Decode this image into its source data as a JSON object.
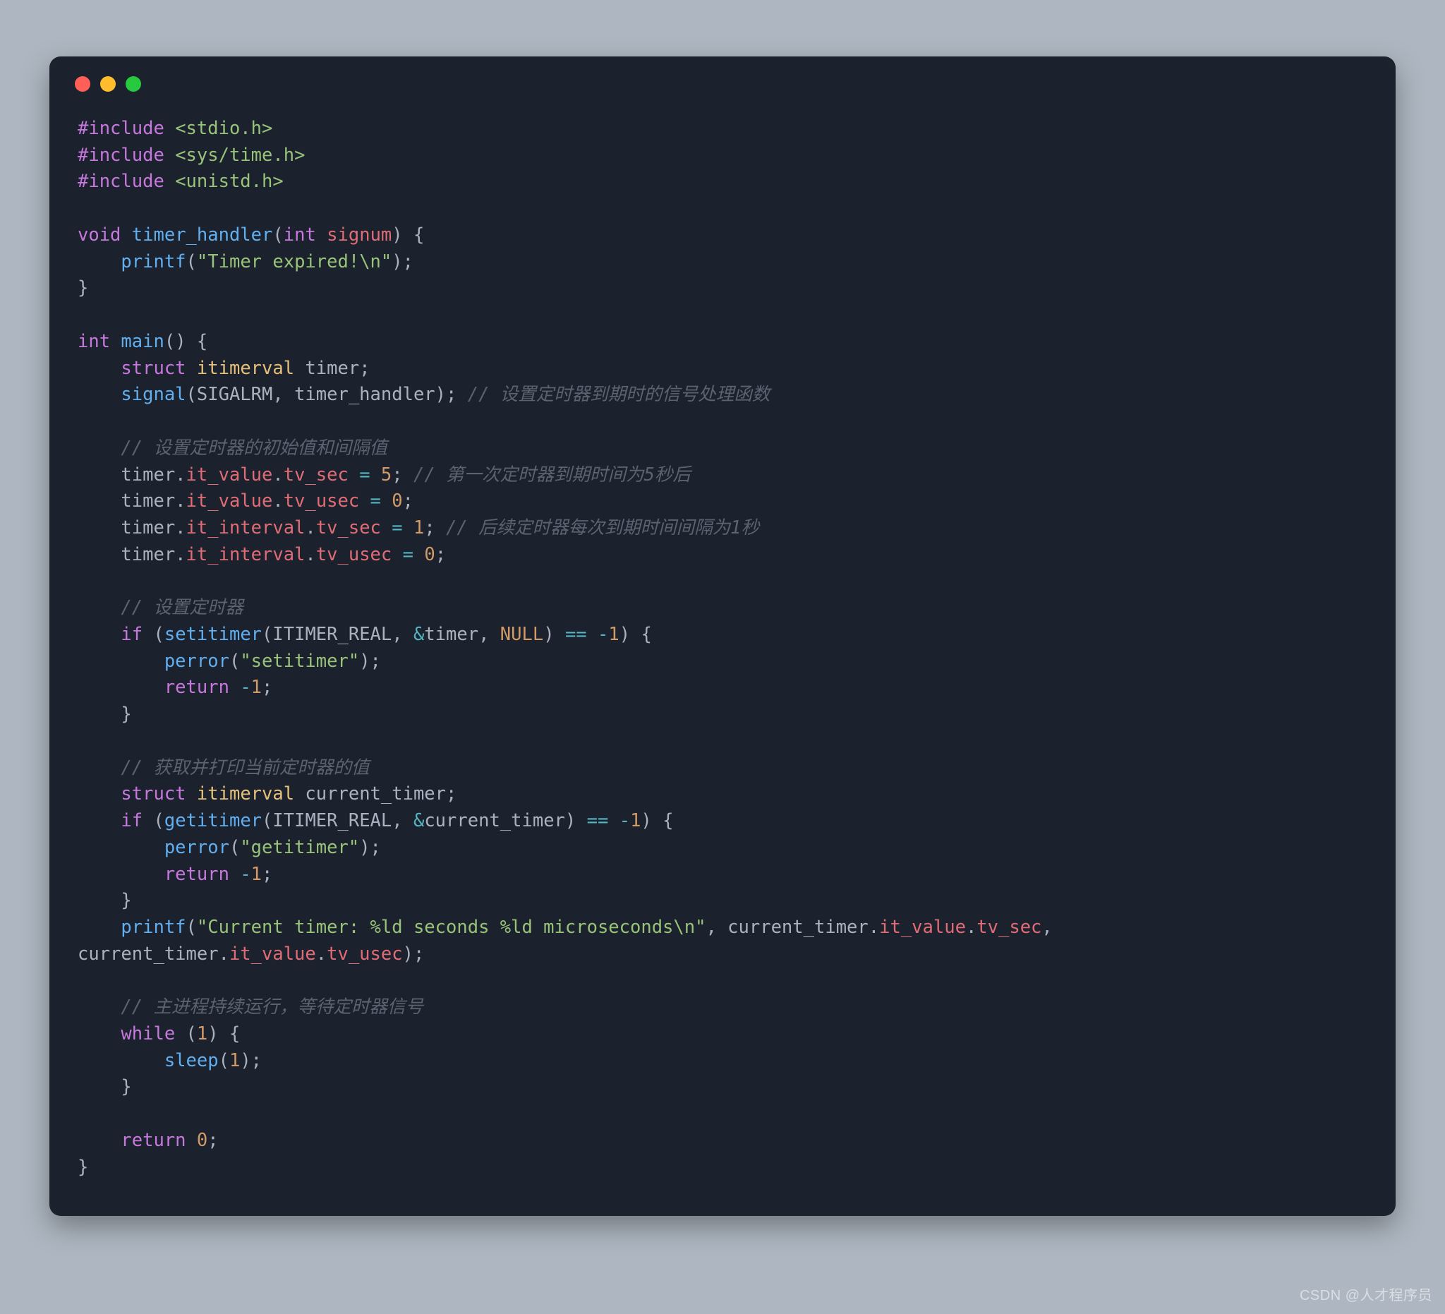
{
  "lines": [
    [
      {
        "c": "tok-pp",
        "t": "#include"
      },
      {
        "c": "tok-pun",
        "t": " "
      },
      {
        "c": "tok-inc",
        "t": "<stdio.h>"
      }
    ],
    [
      {
        "c": "tok-pp",
        "t": "#include"
      },
      {
        "c": "tok-pun",
        "t": " "
      },
      {
        "c": "tok-inc",
        "t": "<sys/time.h>"
      }
    ],
    [
      {
        "c": "tok-pp",
        "t": "#include"
      },
      {
        "c": "tok-pun",
        "t": " "
      },
      {
        "c": "tok-inc",
        "t": "<unistd.h>"
      }
    ],
    [],
    [
      {
        "c": "tok-type",
        "t": "void"
      },
      {
        "c": "tok-pun",
        "t": " "
      },
      {
        "c": "tok-fn",
        "t": "timer_handler"
      },
      {
        "c": "tok-pun",
        "t": "("
      },
      {
        "c": "tok-type",
        "t": "int"
      },
      {
        "c": "tok-pun",
        "t": " "
      },
      {
        "c": "tok-var",
        "t": "signum"
      },
      {
        "c": "tok-pun",
        "t": ") {"
      }
    ],
    [
      {
        "c": "tok-pun",
        "t": "    "
      },
      {
        "c": "tok-fncall",
        "t": "printf"
      },
      {
        "c": "tok-pun",
        "t": "("
      },
      {
        "c": "tok-str",
        "t": "\"Timer expired!\\n\""
      },
      {
        "c": "tok-pun",
        "t": ");"
      }
    ],
    [
      {
        "c": "tok-pun",
        "t": "}"
      }
    ],
    [],
    [
      {
        "c": "tok-type",
        "t": "int"
      },
      {
        "c": "tok-pun",
        "t": " "
      },
      {
        "c": "tok-fn",
        "t": "main"
      },
      {
        "c": "tok-pun",
        "t": "() {"
      }
    ],
    [
      {
        "c": "tok-pun",
        "t": "    "
      },
      {
        "c": "tok-struct",
        "t": "struct"
      },
      {
        "c": "tok-pun",
        "t": " "
      },
      {
        "c": "tok-stype",
        "t": "itimerval"
      },
      {
        "c": "tok-pun",
        "t": " timer;"
      }
    ],
    [
      {
        "c": "tok-pun",
        "t": "    "
      },
      {
        "c": "tok-fncall",
        "t": "signal"
      },
      {
        "c": "tok-pun",
        "t": "(SIGALRM, timer_handler); "
      },
      {
        "c": "tok-cmt",
        "t": "// 设置定时器到期时的信号处理函数"
      }
    ],
    [],
    [
      {
        "c": "tok-pun",
        "t": "    "
      },
      {
        "c": "tok-cmt",
        "t": "// 设置定时器的初始值和间隔值"
      }
    ],
    [
      {
        "c": "tok-pun",
        "t": "    timer."
      },
      {
        "c": "tok-mem",
        "t": "it_value"
      },
      {
        "c": "tok-pun",
        "t": "."
      },
      {
        "c": "tok-mem",
        "t": "tv_sec"
      },
      {
        "c": "tok-pun",
        "t": " "
      },
      {
        "c": "tok-op",
        "t": "="
      },
      {
        "c": "tok-pun",
        "t": " "
      },
      {
        "c": "tok-num",
        "t": "5"
      },
      {
        "c": "tok-pun",
        "t": "; "
      },
      {
        "c": "tok-cmt",
        "t": "// 第一次定时器到期时间为5秒后"
      }
    ],
    [
      {
        "c": "tok-pun",
        "t": "    timer."
      },
      {
        "c": "tok-mem",
        "t": "it_value"
      },
      {
        "c": "tok-pun",
        "t": "."
      },
      {
        "c": "tok-mem",
        "t": "tv_usec"
      },
      {
        "c": "tok-pun",
        "t": " "
      },
      {
        "c": "tok-op",
        "t": "="
      },
      {
        "c": "tok-pun",
        "t": " "
      },
      {
        "c": "tok-num",
        "t": "0"
      },
      {
        "c": "tok-pun",
        "t": ";"
      }
    ],
    [
      {
        "c": "tok-pun",
        "t": "    timer."
      },
      {
        "c": "tok-mem",
        "t": "it_interval"
      },
      {
        "c": "tok-pun",
        "t": "."
      },
      {
        "c": "tok-mem",
        "t": "tv_sec"
      },
      {
        "c": "tok-pun",
        "t": " "
      },
      {
        "c": "tok-op",
        "t": "="
      },
      {
        "c": "tok-pun",
        "t": " "
      },
      {
        "c": "tok-num",
        "t": "1"
      },
      {
        "c": "tok-pun",
        "t": "; "
      },
      {
        "c": "tok-cmt",
        "t": "// 后续定时器每次到期时间间隔为1秒"
      }
    ],
    [
      {
        "c": "tok-pun",
        "t": "    timer."
      },
      {
        "c": "tok-mem",
        "t": "it_interval"
      },
      {
        "c": "tok-pun",
        "t": "."
      },
      {
        "c": "tok-mem",
        "t": "tv_usec"
      },
      {
        "c": "tok-pun",
        "t": " "
      },
      {
        "c": "tok-op",
        "t": "="
      },
      {
        "c": "tok-pun",
        "t": " "
      },
      {
        "c": "tok-num",
        "t": "0"
      },
      {
        "c": "tok-pun",
        "t": ";"
      }
    ],
    [],
    [
      {
        "c": "tok-pun",
        "t": "    "
      },
      {
        "c": "tok-cmt",
        "t": "// 设置定时器"
      }
    ],
    [
      {
        "c": "tok-pun",
        "t": "    "
      },
      {
        "c": "tok-kw",
        "t": "if"
      },
      {
        "c": "tok-pun",
        "t": " ("
      },
      {
        "c": "tok-fncall",
        "t": "setitimer"
      },
      {
        "c": "tok-pun",
        "t": "(ITIMER_REAL, "
      },
      {
        "c": "tok-op",
        "t": "&"
      },
      {
        "c": "tok-pun",
        "t": "timer, "
      },
      {
        "c": "tok-null",
        "t": "NULL"
      },
      {
        "c": "tok-pun",
        "t": ") "
      },
      {
        "c": "tok-op",
        "t": "=="
      },
      {
        "c": "tok-pun",
        "t": " "
      },
      {
        "c": "tok-op",
        "t": "-"
      },
      {
        "c": "tok-num",
        "t": "1"
      },
      {
        "c": "tok-pun",
        "t": ") {"
      }
    ],
    [
      {
        "c": "tok-pun",
        "t": "        "
      },
      {
        "c": "tok-fncall",
        "t": "perror"
      },
      {
        "c": "tok-pun",
        "t": "("
      },
      {
        "c": "tok-str",
        "t": "\"setitimer\""
      },
      {
        "c": "tok-pun",
        "t": ");"
      }
    ],
    [
      {
        "c": "tok-pun",
        "t": "        "
      },
      {
        "c": "tok-kw",
        "t": "return"
      },
      {
        "c": "tok-pun",
        "t": " "
      },
      {
        "c": "tok-op",
        "t": "-"
      },
      {
        "c": "tok-num",
        "t": "1"
      },
      {
        "c": "tok-pun",
        "t": ";"
      }
    ],
    [
      {
        "c": "tok-pun",
        "t": "    }"
      }
    ],
    [],
    [
      {
        "c": "tok-pun",
        "t": "    "
      },
      {
        "c": "tok-cmt",
        "t": "// 获取并打印当前定时器的值"
      }
    ],
    [
      {
        "c": "tok-pun",
        "t": "    "
      },
      {
        "c": "tok-struct",
        "t": "struct"
      },
      {
        "c": "tok-pun",
        "t": " "
      },
      {
        "c": "tok-stype",
        "t": "itimerval"
      },
      {
        "c": "tok-pun",
        "t": " current_timer;"
      }
    ],
    [
      {
        "c": "tok-pun",
        "t": "    "
      },
      {
        "c": "tok-kw",
        "t": "if"
      },
      {
        "c": "tok-pun",
        "t": " ("
      },
      {
        "c": "tok-fncall",
        "t": "getitimer"
      },
      {
        "c": "tok-pun",
        "t": "(ITIMER_REAL, "
      },
      {
        "c": "tok-op",
        "t": "&"
      },
      {
        "c": "tok-pun",
        "t": "current_timer) "
      },
      {
        "c": "tok-op",
        "t": "=="
      },
      {
        "c": "tok-pun",
        "t": " "
      },
      {
        "c": "tok-op",
        "t": "-"
      },
      {
        "c": "tok-num",
        "t": "1"
      },
      {
        "c": "tok-pun",
        "t": ") {"
      }
    ],
    [
      {
        "c": "tok-pun",
        "t": "        "
      },
      {
        "c": "tok-fncall",
        "t": "perror"
      },
      {
        "c": "tok-pun",
        "t": "("
      },
      {
        "c": "tok-str",
        "t": "\"getitimer\""
      },
      {
        "c": "tok-pun",
        "t": ");"
      }
    ],
    [
      {
        "c": "tok-pun",
        "t": "        "
      },
      {
        "c": "tok-kw",
        "t": "return"
      },
      {
        "c": "tok-pun",
        "t": " "
      },
      {
        "c": "tok-op",
        "t": "-"
      },
      {
        "c": "tok-num",
        "t": "1"
      },
      {
        "c": "tok-pun",
        "t": ";"
      }
    ],
    [
      {
        "c": "tok-pun",
        "t": "    }"
      }
    ],
    [
      {
        "c": "tok-pun",
        "t": "    "
      },
      {
        "c": "tok-fncall",
        "t": "printf"
      },
      {
        "c": "tok-pun",
        "t": "("
      },
      {
        "c": "tok-str",
        "t": "\"Current timer: %ld seconds %ld microseconds\\n\""
      },
      {
        "c": "tok-pun",
        "t": ", current_timer."
      },
      {
        "c": "tok-mem",
        "t": "it_value"
      },
      {
        "c": "tok-pun",
        "t": "."
      },
      {
        "c": "tok-mem",
        "t": "tv_sec"
      },
      {
        "c": "tok-pun",
        "t": ", "
      }
    ],
    [
      {
        "c": "tok-pun",
        "t": "current_timer."
      },
      {
        "c": "tok-mem",
        "t": "it_value"
      },
      {
        "c": "tok-pun",
        "t": "."
      },
      {
        "c": "tok-mem",
        "t": "tv_usec"
      },
      {
        "c": "tok-pun",
        "t": ");"
      }
    ],
    [],
    [
      {
        "c": "tok-pun",
        "t": "    "
      },
      {
        "c": "tok-cmt",
        "t": "// 主进程持续运行，等待定时器信号"
      }
    ],
    [
      {
        "c": "tok-pun",
        "t": "    "
      },
      {
        "c": "tok-kw",
        "t": "while"
      },
      {
        "c": "tok-pun",
        "t": " ("
      },
      {
        "c": "tok-num",
        "t": "1"
      },
      {
        "c": "tok-pun",
        "t": ") {"
      }
    ],
    [
      {
        "c": "tok-pun",
        "t": "        "
      },
      {
        "c": "tok-fncall",
        "t": "sleep"
      },
      {
        "c": "tok-pun",
        "t": "("
      },
      {
        "c": "tok-num",
        "t": "1"
      },
      {
        "c": "tok-pun",
        "t": ");"
      }
    ],
    [
      {
        "c": "tok-pun",
        "t": "    }"
      }
    ],
    [],
    [
      {
        "c": "tok-pun",
        "t": "    "
      },
      {
        "c": "tok-kw",
        "t": "return"
      },
      {
        "c": "tok-pun",
        "t": " "
      },
      {
        "c": "tok-num",
        "t": "0"
      },
      {
        "c": "tok-pun",
        "t": ";"
      }
    ],
    [
      {
        "c": "tok-pun",
        "t": "}"
      }
    ]
  ],
  "watermark": "CSDN @人才程序员"
}
